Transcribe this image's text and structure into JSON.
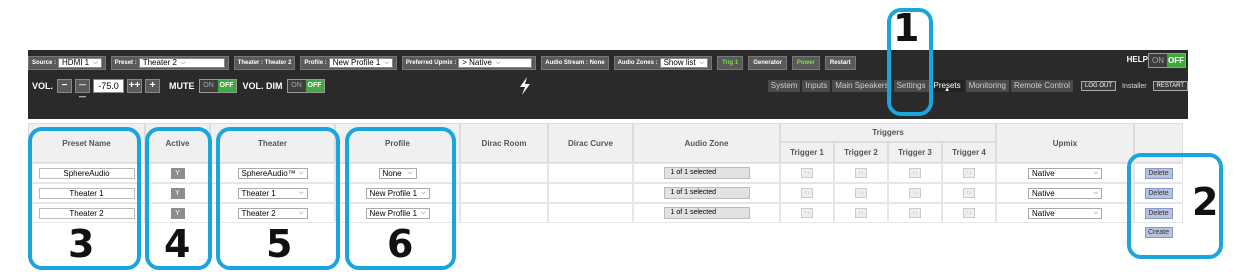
{
  "topbar": {
    "source": {
      "label": "Source :",
      "value": "HDMI 1"
    },
    "preset": {
      "label": "Preset :",
      "value": "Theater 2"
    },
    "theater": {
      "label": "Theater : Theater 2"
    },
    "profile": {
      "label": "Profile :",
      "value": "New Profile 1"
    },
    "upmix": {
      "label": "Preferred Upmix :",
      "value": "> Native"
    },
    "audio_stream": {
      "label": "Audio Stream : None"
    },
    "audio_zones": {
      "label": "Audio Zones :",
      "value": "Show list"
    },
    "trig": "Trig 1",
    "generator": "Generator",
    "power": "Power",
    "restart": "Restart",
    "help": "HELP",
    "help_on": "ON",
    "help_off": "OFF"
  },
  "volume": {
    "label": "VOL.",
    "minus": "−",
    "minus2": "— —",
    "value": "-75.0",
    "plus2": "++",
    "plus": "+",
    "mute_label": "MUTE",
    "mute_on": "ON",
    "mute_off": "OFF",
    "dim_label": "VOL. DIM",
    "dim_on": "ON",
    "dim_off": "OFF"
  },
  "nav": {
    "tabs": [
      "System",
      "Inputs",
      "Main Speakers",
      "Settings",
      "Presets",
      "Monitoring",
      "Remote Control"
    ],
    "active": "Presets",
    "logout": "LOG OUT",
    "installer": "Installer",
    "restart": "RESTART"
  },
  "table": {
    "headers": {
      "preset_name": "Preset Name",
      "active": "Active",
      "theater": "Theater",
      "profile": "Profile",
      "dirac_room": "Dirac Room",
      "dirac_curve": "Dirac Curve",
      "audio_zone": "Audio Zone",
      "triggers": "Triggers",
      "trigger_1": "Trigger 1",
      "trigger_2": "Trigger 2",
      "trigger_3": "Trigger 3",
      "trigger_4": "Trigger 4",
      "upmix": "Upmix"
    },
    "rows": [
      {
        "name": "SphereAudio",
        "active": "Y",
        "theater": "SphereAudio™",
        "profile": "None",
        "zone": "1 of 1 selected",
        "upmix": "Native",
        "delete": "Delete"
      },
      {
        "name": "Theater 1",
        "active": "Y",
        "theater": "Theater 1",
        "profile": "New Profile 1",
        "zone": "1 of 1 selected",
        "upmix": "Native",
        "delete": "Delete"
      },
      {
        "name": "Theater 2",
        "active": "Y",
        "theater": "Theater 2",
        "profile": "New Profile 1",
        "zone": "1 of 1 selected",
        "upmix": "Native",
        "delete": "Delete"
      }
    ],
    "trigger_glyph": "↑↓",
    "create": "Create"
  },
  "annotations": [
    "1",
    "2",
    "3",
    "4",
    "5",
    "6"
  ],
  "colors": {
    "annotation": "#1aa5dc",
    "bar": "#2a2a2a",
    "green": "#3fa83f"
  }
}
